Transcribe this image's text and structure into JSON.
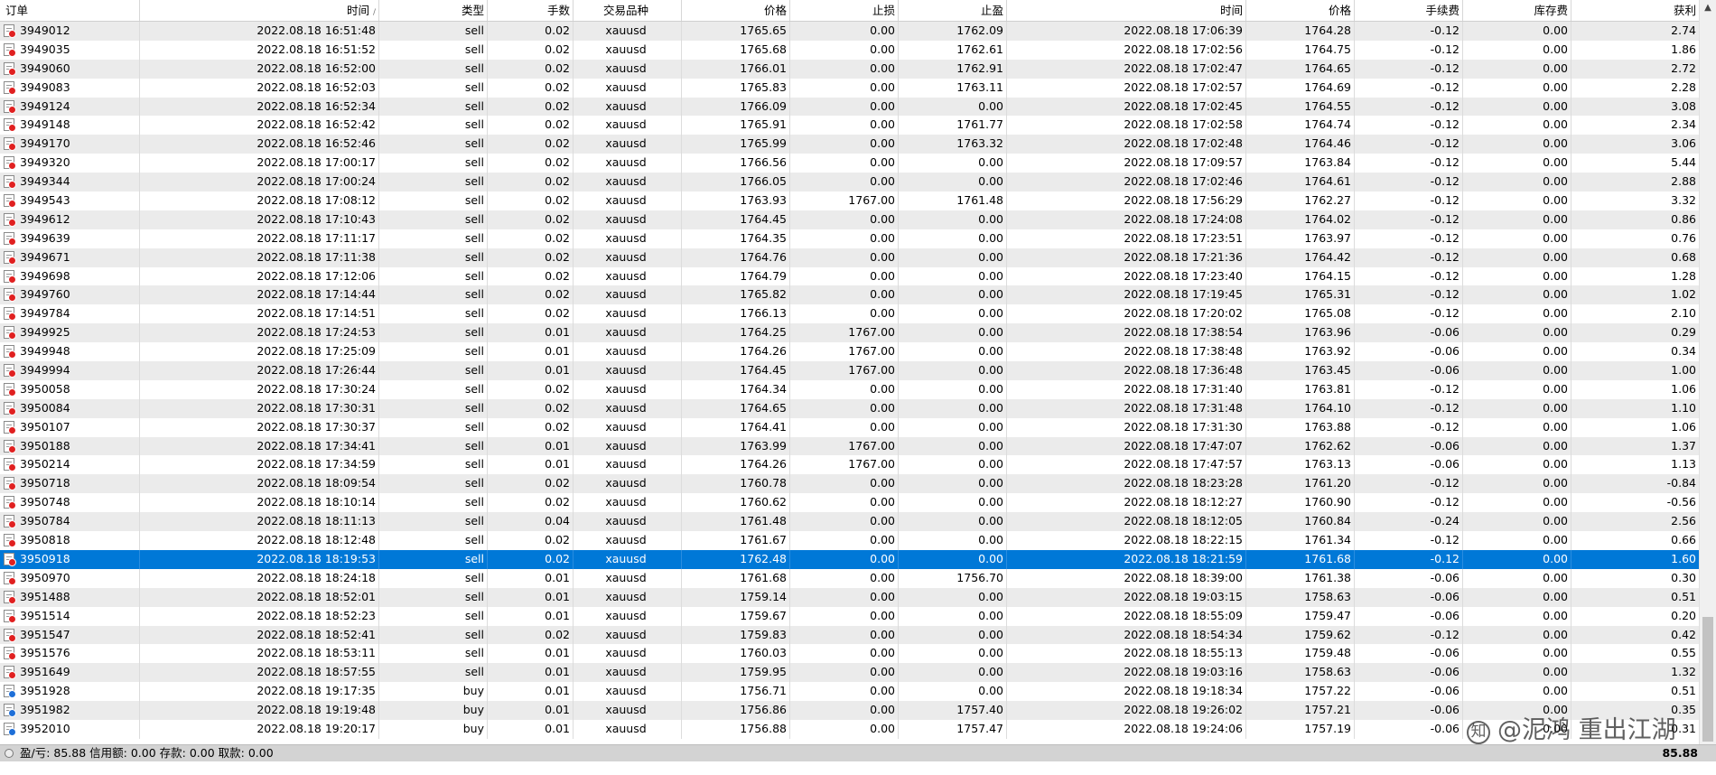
{
  "columns": [
    "订单",
    "时间",
    "类型",
    "手数",
    "交易品种",
    "价格",
    "止损",
    "止盈",
    "时间",
    "价格",
    "手续费",
    "库存费",
    "获利"
  ],
  "sort_indicator": "/",
  "rows": [
    {
      "order": "3949012",
      "open_time": "2022.08.18 16:51:48",
      "type": "sell",
      "lots": "0.02",
      "symbol": "xauusd",
      "open_price": "1765.65",
      "sl": "0.00",
      "tp": "1762.09",
      "close_time": "2022.08.18 17:06:39",
      "close_price": "1764.28",
      "commission": "-0.12",
      "swap": "0.00",
      "profit": "2.74"
    },
    {
      "order": "3949035",
      "open_time": "2022.08.18 16:51:52",
      "type": "sell",
      "lots": "0.02",
      "symbol": "xauusd",
      "open_price": "1765.68",
      "sl": "0.00",
      "tp": "1762.61",
      "close_time": "2022.08.18 17:02:56",
      "close_price": "1764.75",
      "commission": "-0.12",
      "swap": "0.00",
      "profit": "1.86"
    },
    {
      "order": "3949060",
      "open_time": "2022.08.18 16:52:00",
      "type": "sell",
      "lots": "0.02",
      "symbol": "xauusd",
      "open_price": "1766.01",
      "sl": "0.00",
      "tp": "1762.91",
      "close_time": "2022.08.18 17:02:47",
      "close_price": "1764.65",
      "commission": "-0.12",
      "swap": "0.00",
      "profit": "2.72"
    },
    {
      "order": "3949083",
      "open_time": "2022.08.18 16:52:03",
      "type": "sell",
      "lots": "0.02",
      "symbol": "xauusd",
      "open_price": "1765.83",
      "sl": "0.00",
      "tp": "1763.11",
      "close_time": "2022.08.18 17:02:57",
      "close_price": "1764.69",
      "commission": "-0.12",
      "swap": "0.00",
      "profit": "2.28"
    },
    {
      "order": "3949124",
      "open_time": "2022.08.18 16:52:34",
      "type": "sell",
      "lots": "0.02",
      "symbol": "xauusd",
      "open_price": "1766.09",
      "sl": "0.00",
      "tp": "0.00",
      "close_time": "2022.08.18 17:02:45",
      "close_price": "1764.55",
      "commission": "-0.12",
      "swap": "0.00",
      "profit": "3.08"
    },
    {
      "order": "3949148",
      "open_time": "2022.08.18 16:52:42",
      "type": "sell",
      "lots": "0.02",
      "symbol": "xauusd",
      "open_price": "1765.91",
      "sl": "0.00",
      "tp": "1761.77",
      "close_time": "2022.08.18 17:02:58",
      "close_price": "1764.74",
      "commission": "-0.12",
      "swap": "0.00",
      "profit": "2.34"
    },
    {
      "order": "3949170",
      "open_time": "2022.08.18 16:52:46",
      "type": "sell",
      "lots": "0.02",
      "symbol": "xauusd",
      "open_price": "1765.99",
      "sl": "0.00",
      "tp": "1763.32",
      "close_time": "2022.08.18 17:02:48",
      "close_price": "1764.46",
      "commission": "-0.12",
      "swap": "0.00",
      "profit": "3.06"
    },
    {
      "order": "3949320",
      "open_time": "2022.08.18 17:00:17",
      "type": "sell",
      "lots": "0.02",
      "symbol": "xauusd",
      "open_price": "1766.56",
      "sl": "0.00",
      "tp": "0.00",
      "close_time": "2022.08.18 17:09:57",
      "close_price": "1763.84",
      "commission": "-0.12",
      "swap": "0.00",
      "profit": "5.44"
    },
    {
      "order": "3949344",
      "open_time": "2022.08.18 17:00:24",
      "type": "sell",
      "lots": "0.02",
      "symbol": "xauusd",
      "open_price": "1766.05",
      "sl": "0.00",
      "tp": "0.00",
      "close_time": "2022.08.18 17:02:46",
      "close_price": "1764.61",
      "commission": "-0.12",
      "swap": "0.00",
      "profit": "2.88"
    },
    {
      "order": "3949543",
      "open_time": "2022.08.18 17:08:12",
      "type": "sell",
      "lots": "0.02",
      "symbol": "xauusd",
      "open_price": "1763.93",
      "sl": "1767.00",
      "tp": "1761.48",
      "close_time": "2022.08.18 17:56:29",
      "close_price": "1762.27",
      "commission": "-0.12",
      "swap": "0.00",
      "profit": "3.32"
    },
    {
      "order": "3949612",
      "open_time": "2022.08.18 17:10:43",
      "type": "sell",
      "lots": "0.02",
      "symbol": "xauusd",
      "open_price": "1764.45",
      "sl": "0.00",
      "tp": "0.00",
      "close_time": "2022.08.18 17:24:08",
      "close_price": "1764.02",
      "commission": "-0.12",
      "swap": "0.00",
      "profit": "0.86"
    },
    {
      "order": "3949639",
      "open_time": "2022.08.18 17:11:17",
      "type": "sell",
      "lots": "0.02",
      "symbol": "xauusd",
      "open_price": "1764.35",
      "sl": "0.00",
      "tp": "0.00",
      "close_time": "2022.08.18 17:23:51",
      "close_price": "1763.97",
      "commission": "-0.12",
      "swap": "0.00",
      "profit": "0.76"
    },
    {
      "order": "3949671",
      "open_time": "2022.08.18 17:11:38",
      "type": "sell",
      "lots": "0.02",
      "symbol": "xauusd",
      "open_price": "1764.76",
      "sl": "0.00",
      "tp": "0.00",
      "close_time": "2022.08.18 17:21:36",
      "close_price": "1764.42",
      "commission": "-0.12",
      "swap": "0.00",
      "profit": "0.68"
    },
    {
      "order": "3949698",
      "open_time": "2022.08.18 17:12:06",
      "type": "sell",
      "lots": "0.02",
      "symbol": "xauusd",
      "open_price": "1764.79",
      "sl": "0.00",
      "tp": "0.00",
      "close_time": "2022.08.18 17:23:40",
      "close_price": "1764.15",
      "commission": "-0.12",
      "swap": "0.00",
      "profit": "1.28"
    },
    {
      "order": "3949760",
      "open_time": "2022.08.18 17:14:44",
      "type": "sell",
      "lots": "0.02",
      "symbol": "xauusd",
      "open_price": "1765.82",
      "sl": "0.00",
      "tp": "0.00",
      "close_time": "2022.08.18 17:19:45",
      "close_price": "1765.31",
      "commission": "-0.12",
      "swap": "0.00",
      "profit": "1.02"
    },
    {
      "order": "3949784",
      "open_time": "2022.08.18 17:14:51",
      "type": "sell",
      "lots": "0.02",
      "symbol": "xauusd",
      "open_price": "1766.13",
      "sl": "0.00",
      "tp": "0.00",
      "close_time": "2022.08.18 17:20:02",
      "close_price": "1765.08",
      "commission": "-0.12",
      "swap": "0.00",
      "profit": "2.10"
    },
    {
      "order": "3949925",
      "open_time": "2022.08.18 17:24:53",
      "type": "sell",
      "lots": "0.01",
      "symbol": "xauusd",
      "open_price": "1764.25",
      "sl": "1767.00",
      "tp": "0.00",
      "close_time": "2022.08.18 17:38:54",
      "close_price": "1763.96",
      "commission": "-0.06",
      "swap": "0.00",
      "profit": "0.29"
    },
    {
      "order": "3949948",
      "open_time": "2022.08.18 17:25:09",
      "type": "sell",
      "lots": "0.01",
      "symbol": "xauusd",
      "open_price": "1764.26",
      "sl": "1767.00",
      "tp": "0.00",
      "close_time": "2022.08.18 17:38:48",
      "close_price": "1763.92",
      "commission": "-0.06",
      "swap": "0.00",
      "profit": "0.34"
    },
    {
      "order": "3949994",
      "open_time": "2022.08.18 17:26:44",
      "type": "sell",
      "lots": "0.01",
      "symbol": "xauusd",
      "open_price": "1764.45",
      "sl": "1767.00",
      "tp": "0.00",
      "close_time": "2022.08.18 17:36:48",
      "close_price": "1763.45",
      "commission": "-0.06",
      "swap": "0.00",
      "profit": "1.00"
    },
    {
      "order": "3950058",
      "open_time": "2022.08.18 17:30:24",
      "type": "sell",
      "lots": "0.02",
      "symbol": "xauusd",
      "open_price": "1764.34",
      "sl": "0.00",
      "tp": "0.00",
      "close_time": "2022.08.18 17:31:40",
      "close_price": "1763.81",
      "commission": "-0.12",
      "swap": "0.00",
      "profit": "1.06"
    },
    {
      "order": "3950084",
      "open_time": "2022.08.18 17:30:31",
      "type": "sell",
      "lots": "0.02",
      "symbol": "xauusd",
      "open_price": "1764.65",
      "sl": "0.00",
      "tp": "0.00",
      "close_time": "2022.08.18 17:31:48",
      "close_price": "1764.10",
      "commission": "-0.12",
      "swap": "0.00",
      "profit": "1.10"
    },
    {
      "order": "3950107",
      "open_time": "2022.08.18 17:30:37",
      "type": "sell",
      "lots": "0.02",
      "symbol": "xauusd",
      "open_price": "1764.41",
      "sl": "0.00",
      "tp": "0.00",
      "close_time": "2022.08.18 17:31:30",
      "close_price": "1763.88",
      "commission": "-0.12",
      "swap": "0.00",
      "profit": "1.06"
    },
    {
      "order": "3950188",
      "open_time": "2022.08.18 17:34:41",
      "type": "sell",
      "lots": "0.01",
      "symbol": "xauusd",
      "open_price": "1763.99",
      "sl": "1767.00",
      "tp": "0.00",
      "close_time": "2022.08.18 17:47:07",
      "close_price": "1762.62",
      "commission": "-0.06",
      "swap": "0.00",
      "profit": "1.37"
    },
    {
      "order": "3950214",
      "open_time": "2022.08.18 17:34:59",
      "type": "sell",
      "lots": "0.01",
      "symbol": "xauusd",
      "open_price": "1764.26",
      "sl": "1767.00",
      "tp": "0.00",
      "close_time": "2022.08.18 17:47:57",
      "close_price": "1763.13",
      "commission": "-0.06",
      "swap": "0.00",
      "profit": "1.13"
    },
    {
      "order": "3950718",
      "open_time": "2022.08.18 18:09:54",
      "type": "sell",
      "lots": "0.02",
      "symbol": "xauusd",
      "open_price": "1760.78",
      "sl": "0.00",
      "tp": "0.00",
      "close_time": "2022.08.18 18:23:28",
      "close_price": "1761.20",
      "commission": "-0.12",
      "swap": "0.00",
      "profit": "-0.84"
    },
    {
      "order": "3950748",
      "open_time": "2022.08.18 18:10:14",
      "type": "sell",
      "lots": "0.02",
      "symbol": "xauusd",
      "open_price": "1760.62",
      "sl": "0.00",
      "tp": "0.00",
      "close_time": "2022.08.18 18:12:27",
      "close_price": "1760.90",
      "commission": "-0.12",
      "swap": "0.00",
      "profit": "-0.56"
    },
    {
      "order": "3950784",
      "open_time": "2022.08.18 18:11:13",
      "type": "sell",
      "lots": "0.04",
      "symbol": "xauusd",
      "open_price": "1761.48",
      "sl": "0.00",
      "tp": "0.00",
      "close_time": "2022.08.18 18:12:05",
      "close_price": "1760.84",
      "commission": "-0.24",
      "swap": "0.00",
      "profit": "2.56"
    },
    {
      "order": "3950818",
      "open_time": "2022.08.18 18:12:48",
      "type": "sell",
      "lots": "0.02",
      "symbol": "xauusd",
      "open_price": "1761.67",
      "sl": "0.00",
      "tp": "0.00",
      "close_time": "2022.08.18 18:22:15",
      "close_price": "1761.34",
      "commission": "-0.12",
      "swap": "0.00",
      "profit": "0.66"
    },
    {
      "order": "3950918",
      "open_time": "2022.08.18 18:19:53",
      "type": "sell",
      "lots": "0.02",
      "symbol": "xauusd",
      "open_price": "1762.48",
      "sl": "0.00",
      "tp": "0.00",
      "close_time": "2022.08.18 18:21:59",
      "close_price": "1761.68",
      "commission": "-0.12",
      "swap": "0.00",
      "profit": "1.60",
      "selected": true
    },
    {
      "order": "3950970",
      "open_time": "2022.08.18 18:24:18",
      "type": "sell",
      "lots": "0.01",
      "symbol": "xauusd",
      "open_price": "1761.68",
      "sl": "0.00",
      "tp": "1756.70",
      "close_time": "2022.08.18 18:39:00",
      "close_price": "1761.38",
      "commission": "-0.06",
      "swap": "0.00",
      "profit": "0.30"
    },
    {
      "order": "3951488",
      "open_time": "2022.08.18 18:52:01",
      "type": "sell",
      "lots": "0.01",
      "symbol": "xauusd",
      "open_price": "1759.14",
      "sl": "0.00",
      "tp": "0.00",
      "close_time": "2022.08.18 19:03:15",
      "close_price": "1758.63",
      "commission": "-0.06",
      "swap": "0.00",
      "profit": "0.51"
    },
    {
      "order": "3951514",
      "open_time": "2022.08.18 18:52:23",
      "type": "sell",
      "lots": "0.01",
      "symbol": "xauusd",
      "open_price": "1759.67",
      "sl": "0.00",
      "tp": "0.00",
      "close_time": "2022.08.18 18:55:09",
      "close_price": "1759.47",
      "commission": "-0.06",
      "swap": "0.00",
      "profit": "0.20"
    },
    {
      "order": "3951547",
      "open_time": "2022.08.18 18:52:41",
      "type": "sell",
      "lots": "0.02",
      "symbol": "xauusd",
      "open_price": "1759.83",
      "sl": "0.00",
      "tp": "0.00",
      "close_time": "2022.08.18 18:54:34",
      "close_price": "1759.62",
      "commission": "-0.12",
      "swap": "0.00",
      "profit": "0.42"
    },
    {
      "order": "3951576",
      "open_time": "2022.08.18 18:53:11",
      "type": "sell",
      "lots": "0.01",
      "symbol": "xauusd",
      "open_price": "1760.03",
      "sl": "0.00",
      "tp": "0.00",
      "close_time": "2022.08.18 18:55:13",
      "close_price": "1759.48",
      "commission": "-0.06",
      "swap": "0.00",
      "profit": "0.55"
    },
    {
      "order": "3951649",
      "open_time": "2022.08.18 18:57:55",
      "type": "sell",
      "lots": "0.01",
      "symbol": "xauusd",
      "open_price": "1759.95",
      "sl": "0.00",
      "tp": "0.00",
      "close_time": "2022.08.18 19:03:16",
      "close_price": "1758.63",
      "commission": "-0.06",
      "swap": "0.00",
      "profit": "1.32"
    },
    {
      "order": "3951928",
      "open_time": "2022.08.18 19:17:35",
      "type": "buy",
      "lots": "0.01",
      "symbol": "xauusd",
      "open_price": "1756.71",
      "sl": "0.00",
      "tp": "0.00",
      "close_time": "2022.08.18 19:18:34",
      "close_price": "1757.22",
      "commission": "-0.06",
      "swap": "0.00",
      "profit": "0.51"
    },
    {
      "order": "3951982",
      "open_time": "2022.08.18 19:19:48",
      "type": "buy",
      "lots": "0.01",
      "symbol": "xauusd",
      "open_price": "1756.86",
      "sl": "0.00",
      "tp": "1757.40",
      "close_time": "2022.08.18 19:26:02",
      "close_price": "1757.21",
      "commission": "-0.06",
      "swap": "0.00",
      "profit": "0.35"
    },
    {
      "order": "3952010",
      "open_time": "2022.08.18 19:20:17",
      "type": "buy",
      "lots": "0.01",
      "symbol": "xauusd",
      "open_price": "1756.88",
      "sl": "0.00",
      "tp": "1757.47",
      "close_time": "2022.08.18 19:24:06",
      "close_price": "1757.19",
      "commission": "-0.06",
      "swap": "0.00",
      "profit": "0.31"
    }
  ],
  "footer": {
    "summary": "盈/亏: 85.88  信用额: 0.00  存款: 0.00  取款: 0.00",
    "total": "85.88"
  },
  "watermark": {
    "text": "@泥鸿 重出江湖"
  },
  "colors": {
    "selected_row": "#0078d7",
    "sell_dot": "#e02020",
    "buy_dot": "#1e6fd8",
    "alt_row": "#ebebeb",
    "footer_bg": "#d3d3d3"
  },
  "icons": {
    "sell_order": "document-red-dot-icon",
    "buy_order": "document-blue-dot-icon",
    "scroll_up": "▲",
    "watermark_logo": "知"
  }
}
